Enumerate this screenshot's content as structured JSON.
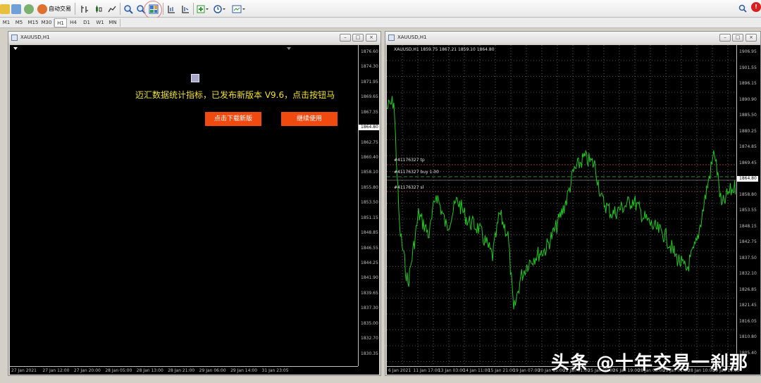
{
  "toolbar": {
    "autotrade_label": "自动交易",
    "buttons": [
      "new-chart",
      "profiles",
      "market-watch",
      "autotrade",
      "bar-chart",
      "candle-chart",
      "line-chart",
      "zoom-in",
      "zoom-out",
      "tile-windows",
      "grid",
      "auto-scroll",
      "indicators",
      "periods",
      "templates"
    ]
  },
  "timeframes": [
    "M1",
    "M5",
    "M15",
    "M30",
    "H1",
    "H4",
    "D1",
    "W1",
    "MN"
  ],
  "active_timeframe": "H1",
  "left_window": {
    "title": "XAUUSD,H1",
    "price_labels": [
      "1876.60",
      "1874.30",
      "1871.95",
      "1869.65",
      "1867.35",
      "1864.80",
      "1862.75",
      "1860.40",
      "1858.10",
      "1855.80",
      "1853.50",
      "1851.15",
      "1848.85",
      "1846.55",
      "1844.25",
      "1841.90",
      "1839.65",
      "1837.30",
      "1835.00",
      "1832.70",
      "1830.35"
    ],
    "current_price": "1864.80",
    "time_labels": [
      "27 Jan 2021",
      "27 Jan 12:00",
      "27 Jan 20:00",
      "28 Jan 05:00",
      "28 Jan 13:00",
      "28 Jan 21:00",
      "29 Jan 06:00",
      "29 Jan 14:00",
      "31 Jan 23:05"
    ],
    "ad_text": "迈汇数据统计指标，已发布新版本 V9.6，点击按钮马",
    "download_button": "点击下载新版",
    "continue_button": "继续使用"
  },
  "right_window": {
    "title": "XAUUSD,H1",
    "info": "XAUUSD,H1  1859.75 1867.21 1859.10 1864.80",
    "price_labels": [
      "1906.95",
      "1901.55",
      "1896.15",
      "1890.90",
      "1885.50",
      "1880.25",
      "1874.85",
      "1869.45",
      "1864.80",
      "1858.80",
      "1853.55",
      "1848.15",
      "1842.75",
      "1837.50",
      "1832.10",
      "1826.85",
      "1821.45",
      "1816.05",
      "1810.80",
      "1805.40"
    ],
    "current_price": "1864.80",
    "time_labels": [
      "6 Jan 2021",
      "11 Jan 17:00",
      "13 Jan 03:00",
      "14 Jan 11:00",
      "15 Jan 21:00",
      "19 Jan 07:00",
      "20 Jan 15:00",
      "22 Jan 01:00",
      "25 Jan 09:00",
      "26 Jan 19:00",
      "28 Jan 03:00",
      "29 Jan 01:00",
      "28 Jan 10:00",
      "29 Jan 19:00"
    ],
    "order_tp": "#41176327 tp",
    "order_buy": "#41176327 buy 1.00",
    "order_sl": "#41176327 sl"
  },
  "watermark": "头条 @十年交易一刹那"
}
